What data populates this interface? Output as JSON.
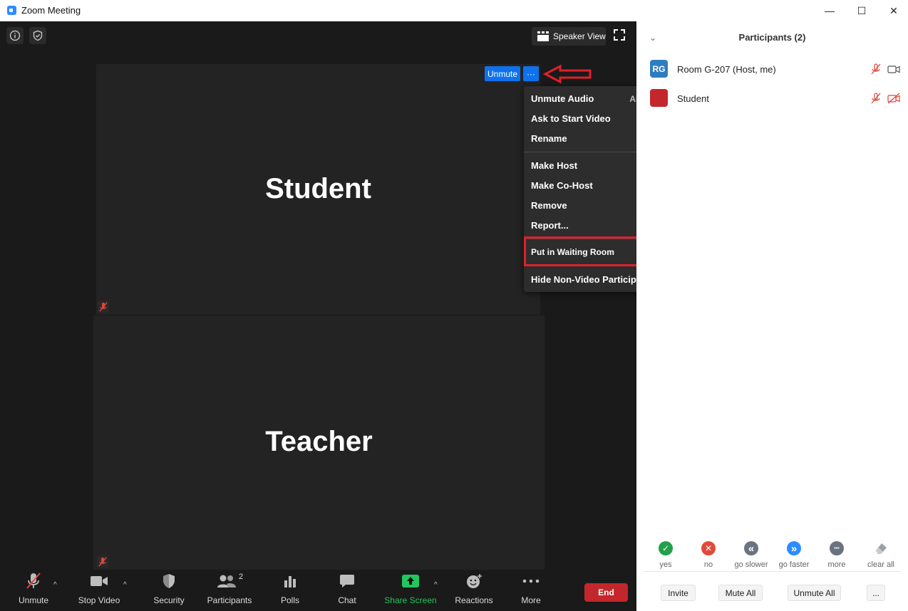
{
  "window": {
    "title": "Zoom Meeting",
    "minimize": "—",
    "maximize": "☐",
    "close": "✕"
  },
  "topbar": {
    "speaker_view_label": "Speaker View"
  },
  "tiles": [
    {
      "name": "Student"
    },
    {
      "name": "Teacher"
    }
  ],
  "hover": {
    "unmute_label": "Unmute",
    "more_label": "···"
  },
  "context_menu": {
    "items": [
      {
        "label": "Unmute Audio",
        "shortcut": "Alt+A"
      },
      {
        "label": "Ask to Start Video"
      },
      {
        "label": "Rename"
      },
      {
        "label": "Make Host"
      },
      {
        "label": "Make Co-Host"
      },
      {
        "label": "Remove"
      },
      {
        "label": "Report..."
      },
      {
        "label": "Put in Waiting Room"
      },
      {
        "label": "Hide Non-Video Participants"
      }
    ]
  },
  "toolbar": {
    "unmute": "Unmute",
    "stop_video": "Stop Video",
    "security": "Security",
    "participants": "Participants",
    "participants_count": "2",
    "polls": "Polls",
    "chat": "Chat",
    "share_screen": "Share Screen",
    "reactions": "Reactions",
    "more": "More",
    "end": "End"
  },
  "panel": {
    "title": "Participants (2)",
    "participants": [
      {
        "initials": "RG",
        "name": "Room G-207 (Host, me)",
        "avatar_color": "#2f7dbf"
      },
      {
        "initials": "",
        "name": "Student",
        "avatar_color": "#c3272b"
      }
    ],
    "feedback": [
      {
        "label": "yes",
        "symbol": "✓",
        "color": "#22a04a"
      },
      {
        "label": "no",
        "symbol": "✕",
        "color": "#e04a3a"
      },
      {
        "label": "go slower",
        "symbol": "«",
        "color": "#6b7280"
      },
      {
        "label": "go faster",
        "symbol": "»",
        "color": "#2d8cff"
      },
      {
        "label": "more",
        "symbol": "•••",
        "color": "#6b7280"
      },
      {
        "label": "clear all",
        "symbol": "",
        "color": "#9aa0a6"
      }
    ],
    "buttons": {
      "invite": "Invite",
      "mute_all": "Mute All",
      "unmute_all": "Unmute All",
      "more": "..."
    }
  },
  "colors": {
    "accent_blue": "#0e72ed",
    "end_red": "#c3272b",
    "share_green": "#22c55e",
    "annotation_red": "#e0202b"
  }
}
